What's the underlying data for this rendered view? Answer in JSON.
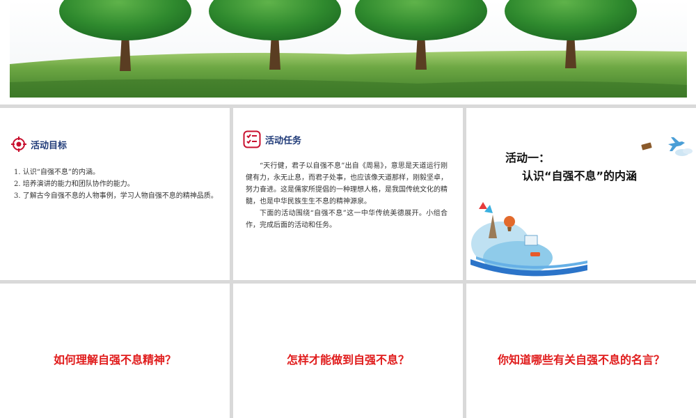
{
  "goals_section": {
    "heading": "活动目标",
    "items": [
      "1. 认识“自强不息”的内涵。",
      "2. 培养演讲的能力和团队协作的能力。",
      "3. 了解古今自强不息的人物事例，学习人物自强不息的精神品质。"
    ]
  },
  "tasks_section": {
    "heading": "活动任务",
    "paragraphs": [
      "“天行健，君子以自强不息”出自《周易》，意思是天道运行刚健有力，永无止息，而君子处事，也应该像天道那样，刚毅坚卓，努力奋进。这是儒家所提倡的一种理想人格，是我国传统文化的精髓，也是中华民族生生不息的精神源泉。",
      "下面的活动围绕“自强不息”这一中华传统美德展开。小组合作，完成后面的活动和任务。"
    ]
  },
  "activity_one": {
    "title": "活动一：",
    "subtitle": "认识“自强不息”的内涵"
  },
  "questions": [
    "如何理解自强不息精神？",
    "怎样才能做到自强不息？",
    "你知道哪些有关自强不息的名言？"
  ],
  "colors": {
    "heading_blue": "#1f3a78",
    "question_red": "#e01b1b",
    "icon_red": "#c8102e"
  }
}
